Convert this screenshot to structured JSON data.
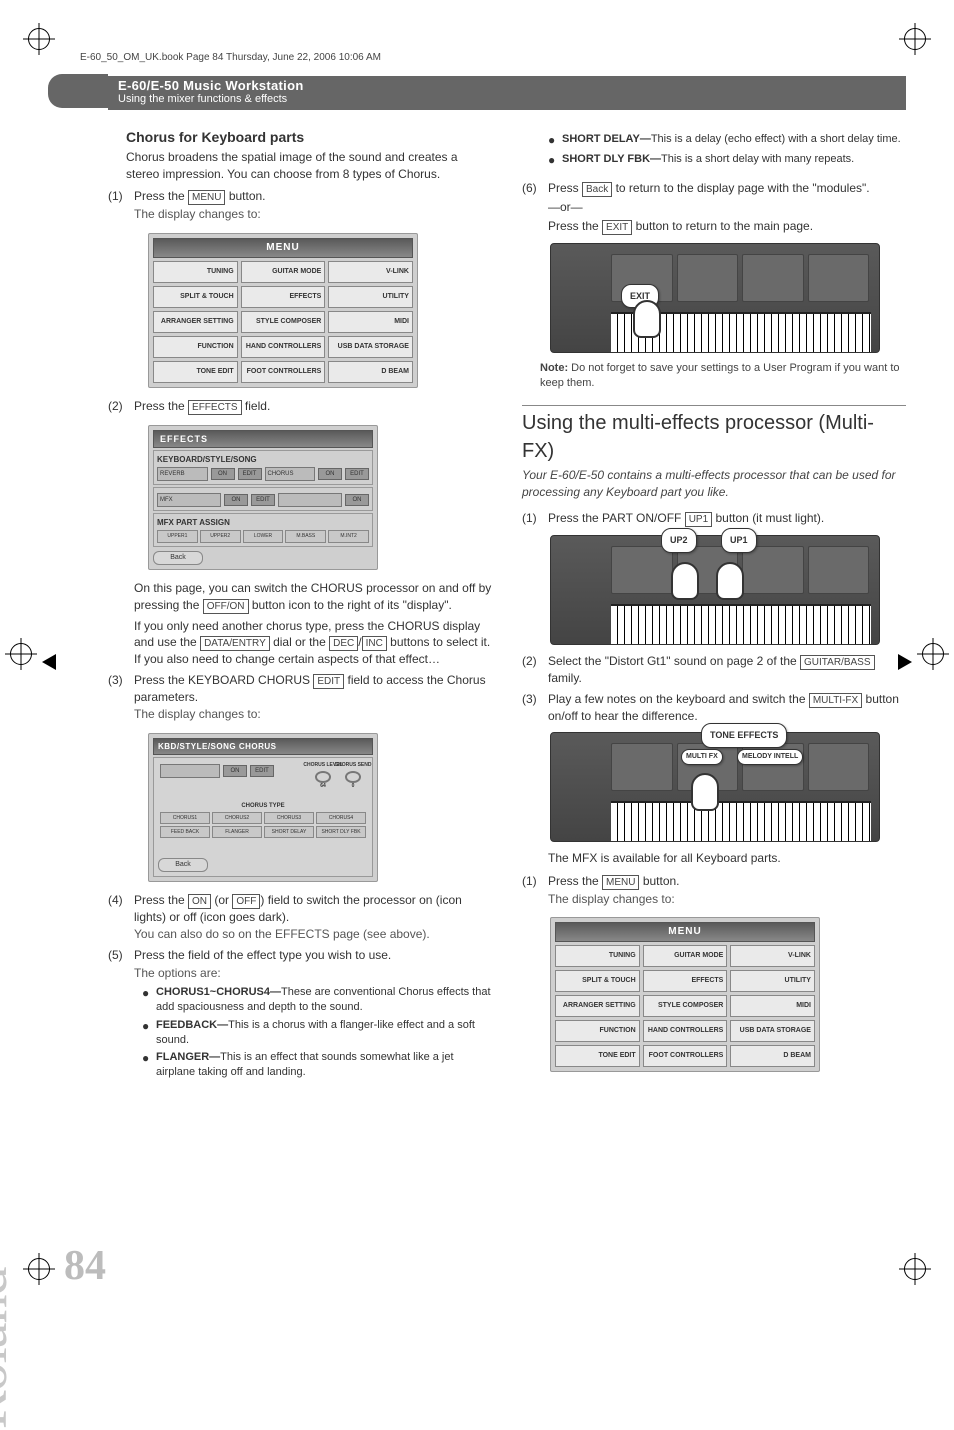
{
  "book_header": "E-60_50_OM_UK.book  Page 84  Thursday, June 22, 2006  10:06 AM",
  "header": {
    "title": "E-60/E-50 Music Workstation",
    "subtitle": "Using the mixer functions & effects"
  },
  "brand": "Roland",
  "page_number": "84",
  "menu_screen": {
    "title": "MENU",
    "cells": [
      "TUNING",
      "GUITAR MODE",
      "V-LINK",
      "SPLIT & TOUCH",
      "EFFECTS",
      "UTILITY",
      "ARRANGER SETTING",
      "STYLE COMPOSER",
      "MIDI",
      "FUNCTION",
      "HAND CONTROLLERS",
      "USB DATA STORAGE",
      "TONE EDIT",
      "FOOT CONTROLLERS",
      "D BEAM"
    ]
  },
  "effects_screen": {
    "title": "EFFECTS",
    "section1": "KEYBOARD/STYLE/SONG",
    "row1_left": "REVERB",
    "row1_right": "CHORUS",
    "on": "ON",
    "edit": "EDIT",
    "section2": "MFX PART ASSIGN",
    "assign_cells": [
      "UPPER1",
      "UPPER2",
      "LOWER",
      "M.BASS",
      "M.INT2"
    ],
    "back": "Back"
  },
  "chorus_screen": {
    "title": "KBD/STYLE/SONG CHORUS",
    "knob1": "CHORUS LEVEL",
    "knob1_val": "64",
    "knob2": "CHORUS SEND",
    "knob2_val": "0",
    "type_label": "CHORUS TYPE",
    "row1": [
      "CHORUS1",
      "CHORUS2",
      "CHORUS3",
      "CHORUS4"
    ],
    "row2": [
      "FEED BACK",
      "FLANGER",
      "SHORT DELAY",
      "SHORT DLY FBK"
    ],
    "back": "Back"
  },
  "left": {
    "h3": "Chorus for Keyboard parts",
    "intro": "Chorus broadens the spatial image of the sound and creates a stereo impression. You can choose from 8 types of Chorus.",
    "s1_num": "(1)",
    "s1_a": "Press the ",
    "s1_btn": "MENU",
    "s1_b": " button.",
    "s1_sub": "The display changes to:",
    "s2_num": "(2)",
    "s2_a": "Press the ",
    "s2_btn": "EFFECTS",
    "s2_b": " field.",
    "s2_p1a": "On this page, you can switch the CHORUS processor on and off by pressing the ",
    "s2_btn2": "OFF/ON",
    "s2_p1b": " button icon to the right of its \"display\".",
    "s2_p2a": "If you only need another chorus type, press the CHORUS display and use the ",
    "s2_btn3": "DATA/ENTRY",
    "s2_p2b": " dial or the ",
    "s2_btn4": "DEC",
    "s2_p2c": "/",
    "s2_btn5": "INC",
    "s2_p2d": " buttons to select it. If you also need to change certain aspects of that effect…",
    "s3_num": "(3)",
    "s3_a": "Press the KEYBOARD CHORUS ",
    "s3_btn": "EDIT",
    "s3_b": " field to access the Chorus parameters.",
    "s3_sub": "The display changes to:",
    "s4_num": "(4)",
    "s4_a": "Press the ",
    "s4_btn1": "ON",
    "s4_b": " (or ",
    "s4_btn2": "OFF",
    "s4_c": ") field to switch the processor on (icon lights) or off (icon goes dark).",
    "s4_sub": "You can also do so on the EFFECTS page (see above).",
    "s5_num": "(5)",
    "s5_a": "Press the field of the effect type you wish to use.",
    "s5_sub": "The options are:",
    "b1_label": "CHORUS1~CHORUS4—",
    "b1": "These are conventional Chorus effects that add spaciousness and depth to the sound.",
    "b2_label": "FEEDBACK—",
    "b2": "This is a chorus with a flanger-like effect and a soft sound.",
    "b3_label": "FLANGER—",
    "b3": "This is an effect that sounds somewhat like a jet airplane taking off and landing."
  },
  "right": {
    "b4_label": "SHORT DELAY—",
    "b4": "This is a delay (echo effect) with a short delay time.",
    "b5_label": "SHORT DLY FBK—",
    "b5": "This is a short delay with many repeats.",
    "s6_num": "(6)",
    "s6_a": "Press ",
    "s6_btn1": "Back",
    "s6_b": " to return to the display page with the \"modules\".",
    "s6_or": "—or—",
    "s6_c": "Press the ",
    "s6_btn2": "EXIT",
    "s6_d": " button to return to the main page.",
    "kb1_callout": "EXIT",
    "note_label": "Note: ",
    "note": "Do not forget to save your settings to a User Program if you want to keep them.",
    "h2": "Using the multi-effects processor (Multi-FX)",
    "h2_sub": "Your E-60/E-50 contains a multi-effects processor that can be used for processing any Keyboard part you like.",
    "m1_num": "(1)",
    "m1_a": "Press the PART ON/OFF ",
    "m1_btn": "UP1",
    "m1_b": " button (it must light).",
    "kb2_c1": "UP2",
    "kb2_c2": "UP1",
    "m2_num": "(2)",
    "m2_a": "Select the \"Distort Gt1\" sound on page 2 of the ",
    "m2_btn": "GUITAR/BASS",
    "m2_b": " family.",
    "m3_num": "(3)",
    "m3_a": "Play a few notes on the keyboard and switch the ",
    "m3_btn": "MULTI-FX",
    "m3_b": " button on/off to hear the difference.",
    "kb3_title": "TONE EFFECTS",
    "kb3_b1": "MULTI FX",
    "kb3_b2": "MELODY INTELL",
    "m3_sub": "The MFX is available for all Keyboard parts.",
    "m4_num": "(1)",
    "m4_a": "Press the ",
    "m4_btn": "MENU",
    "m4_b": " button.",
    "m4_sub": "The display changes to:"
  }
}
